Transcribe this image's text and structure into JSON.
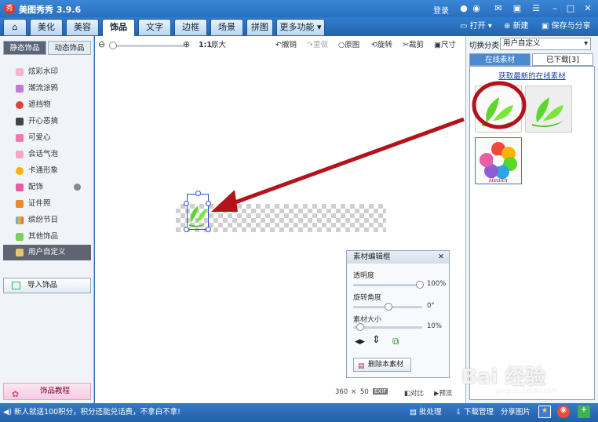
{
  "titlebar": {
    "app_title": "美图秀秀 3.9.6",
    "login": "登录"
  },
  "tabs": [
    "美化",
    "美容",
    "饰品",
    "文字",
    "边框",
    "场景",
    "拼图",
    "更多功能"
  ],
  "tab_active": "饰品",
  "tabbar_right": {
    "open": "打开",
    "new": "新建",
    "save_share": "保存与分享"
  },
  "left_panel": {
    "subtabs": [
      "静态饰品",
      "动态饰品"
    ],
    "items": [
      "炫彩水印",
      "潮流涂鸦",
      "遮挡物",
      "开心恶搞",
      "可爱心",
      "会话气泡",
      "卡通形象",
      "配饰",
      "证件照",
      "缤纷节日",
      "其他饰品",
      "用户自定义"
    ],
    "selected": "用户自定义",
    "import_button": "导入饰品",
    "tutorial_button": "饰品教程"
  },
  "toolbar": {
    "zoom_ratio": "1:1",
    "original_size": "原大",
    "undo": "撤销",
    "redo": "重做",
    "original": "原图",
    "rotate": "旋转",
    "crop": "裁剪",
    "size": "尺寸"
  },
  "material_panel": {
    "title": "素材编辑框",
    "opacity_label": "透明度",
    "opacity_value": "100%",
    "rotation_label": "旋转角度",
    "rotation_value": "0°",
    "size_label": "素材大小",
    "size_value": "10%",
    "delete_button": "删除本素材",
    "opacity_level": 1.0,
    "rotation_level": 0.5,
    "size_level": 0.05
  },
  "canvas_status": {
    "width": "360",
    "times": "×",
    "height": "50",
    "exif": "EXIF",
    "compare": "对比",
    "preview": "预览"
  },
  "right_panel": {
    "category_label": "切换分类",
    "category_value": "用户自定义",
    "tabs": [
      "在线素材",
      "已下载[3]"
    ],
    "active_tab": "已下载[3]",
    "online_link": "获取最新的在线素材",
    "thumb_caption": "Health"
  },
  "bottombar": {
    "notice": "新人就送100积分，积分还能兑话费，不拿白不拿!",
    "batch": "批处理",
    "download": "下载管理",
    "share": "分享图片"
  },
  "watermark": {
    "text": "Bai 经验",
    "url": "jingyan.baidu.com"
  },
  "colors": {
    "accent": "#2f6fb5",
    "leaf_green": "#5dd62c",
    "annotation_red": "#b3131b",
    "selection_blue": "#2e4ed6"
  }
}
